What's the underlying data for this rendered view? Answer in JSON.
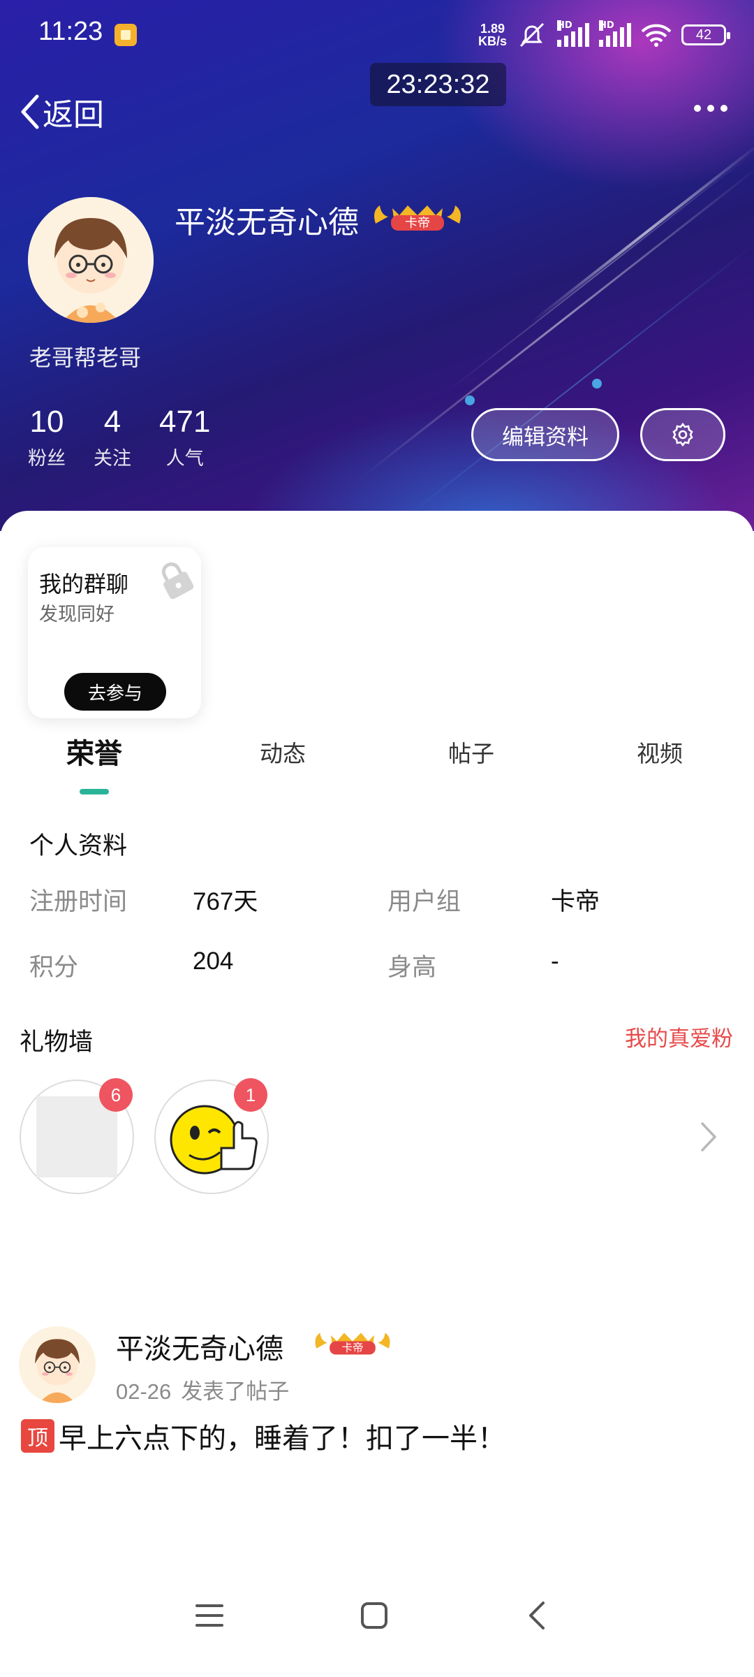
{
  "status_bar": {
    "time": "11:23",
    "net_speed_value": "1.89",
    "net_speed_unit": "KB/s",
    "hd1": "HD",
    "hd2": "HD",
    "battery": "42"
  },
  "clock_overlay": "23:23:32",
  "nav": {
    "back_label": "返回"
  },
  "profile": {
    "username": "平淡无奇心德",
    "rank_badge": "卡帝",
    "bio": "老哥帮老哥",
    "stats": [
      {
        "value": "10",
        "label": "粉丝"
      },
      {
        "value": "4",
        "label": "关注"
      },
      {
        "value": "471",
        "label": "人气"
      }
    ],
    "edit_button": "编辑资料"
  },
  "group_card": {
    "title": "我的群聊",
    "subtitle": "发现同好",
    "button": "去参与"
  },
  "tabs": [
    {
      "label": "荣誉",
      "active": true
    },
    {
      "label": "动态",
      "active": false
    },
    {
      "label": "帖子",
      "active": false
    },
    {
      "label": "视频",
      "active": false
    }
  ],
  "info": {
    "title": "个人资料",
    "register_label": "注册时间",
    "register_value": "767天",
    "group_label": "用户组",
    "group_value": "卡帝",
    "points_label": "积分",
    "points_value": "204",
    "height_label": "身高",
    "height_value": "-"
  },
  "gift_wall": {
    "title": "礼物墙",
    "link": "我的真爱粉",
    "gifts": [
      {
        "count": "6",
        "icon": "blank-gift"
      },
      {
        "count": "1",
        "icon": "thumbs-up-emoji"
      }
    ]
  },
  "post": {
    "username": "平淡无奇心德",
    "rank_badge": "卡帝",
    "date": "02-26",
    "action": "发表了帖子",
    "pin_tag": "顶",
    "text": "早上六点下的，睡着了！扣了一半！"
  },
  "colors": {
    "accent_tab": "#2ab398",
    "link_red": "#e74b4b",
    "badge_red": "#ee5560",
    "pin_red": "#e8473f"
  }
}
